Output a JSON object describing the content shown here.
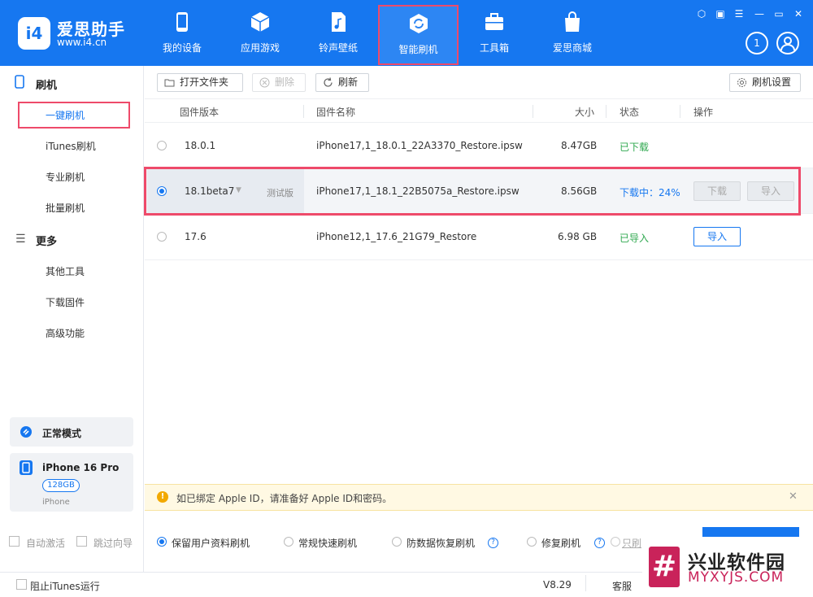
{
  "app": {
    "logo_mark": "i4",
    "name": "爱思助手",
    "url": "www.i4.cn"
  },
  "nav": [
    {
      "label": "我的设备",
      "icon": "phone-icon"
    },
    {
      "label": "应用游戏",
      "icon": "cube-icon"
    },
    {
      "label": "铃声壁纸",
      "icon": "music-file-icon"
    },
    {
      "label": "智能刷机",
      "icon": "flash-refresh-icon"
    },
    {
      "label": "工具箱",
      "icon": "toolbox-icon"
    },
    {
      "label": "爱思商城",
      "icon": "shopping-bag-icon"
    }
  ],
  "header_right": {
    "download_count": "1"
  },
  "sidebar": {
    "section1": "刷机",
    "items1": [
      "一键刷机",
      "iTunes刷机",
      "专业刷机",
      "批量刷机"
    ],
    "section2": "更多",
    "items2": [
      "其他工具",
      "下载固件",
      "高级功能"
    ],
    "mode": "正常模式",
    "device": {
      "name": "iPhone 16 Pro",
      "storage": "128GB",
      "type": "iPhone"
    },
    "auto_activate": "自动激活",
    "skip_guide": "跳过向导"
  },
  "toolbar": {
    "open_folder": "打开文件夹",
    "delete": "删除",
    "refresh": "刷新",
    "settings": "刷机设置"
  },
  "table": {
    "headers": {
      "version": "固件版本",
      "name": "固件名称",
      "size": "大小",
      "status": "状态",
      "action": "操作"
    },
    "rows": [
      {
        "version": "18.0.1",
        "tag": "",
        "name": "iPhone17,1_18.0.1_22A3370_Restore.ipsw",
        "size": "8.47GB",
        "status": "已下载",
        "status_color": "#2fa84f"
      },
      {
        "version": "18.1beta7",
        "tag": "测试版",
        "name": "iPhone17,1_18.1_22B5075a_Restore.ipsw",
        "size": "8.56GB",
        "status": "下载中：24%",
        "status_color": "#1677f0",
        "btn_download": "下载",
        "btn_import": "导入"
      },
      {
        "version": "17.6",
        "tag": "",
        "name": "iPhone12,1_17.6_21G79_Restore",
        "size": "6.98 GB",
        "status": "已导入",
        "status_color": "#2fa84f",
        "btn_import": "导入"
      }
    ]
  },
  "notice": "如已绑定 Apple ID，请准备好 Apple ID和密码。",
  "options": {
    "keep_data": "保留用户资料刷机",
    "normal_fast": "常规快速刷机",
    "anti_data_recovery": "防数据恢复刷机",
    "repair": "修复刷机",
    "only": "只刷"
  },
  "footer": {
    "block_itunes": "阻止iTunes运行",
    "version": "V8.29",
    "service": "客服"
  },
  "watermark": {
    "mark": "#",
    "title": "兴业软件园",
    "url": "MYXYJS.COM"
  },
  "colors": {
    "brand": "#1677f0",
    "highlight": "#ee4a6a",
    "success": "#2fa84f"
  }
}
